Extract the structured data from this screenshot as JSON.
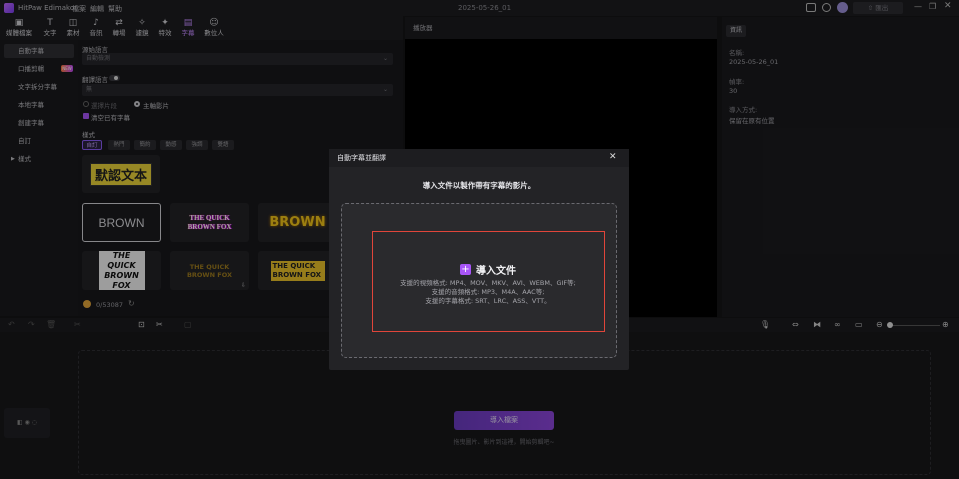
{
  "titlebar": {
    "app_name": "HitPaw Edimakor",
    "menu": [
      "檔案",
      "編輯",
      "幫助"
    ],
    "project_name": "2025-05-26_01",
    "export_label": "匯出"
  },
  "toolbar": {
    "items": [
      {
        "label": "媒體檔案",
        "icon": "media-icon"
      },
      {
        "label": "文字",
        "icon": "text-icon"
      },
      {
        "label": "素材",
        "icon": "elements-icon"
      },
      {
        "label": "音訊",
        "icon": "audio-icon"
      },
      {
        "label": "轉場",
        "icon": "transition-icon"
      },
      {
        "label": "濾鏡",
        "icon": "filter-icon"
      },
      {
        "label": "特效",
        "icon": "effects-icon"
      },
      {
        "label": "字幕",
        "icon": "subtitle-icon"
      },
      {
        "label": "數位人",
        "icon": "avatar-icon"
      }
    ],
    "active": "字幕"
  },
  "sidebar": {
    "items": [
      {
        "label": "自動字幕"
      },
      {
        "label": "口播剪輯"
      },
      {
        "label": "文字拆分字幕"
      },
      {
        "label": "本地字幕"
      },
      {
        "label": "創建字幕"
      },
      {
        "label": "自訂"
      },
      {
        "label": "樣式"
      }
    ],
    "new_badge": "NEW"
  },
  "subtitle_panel": {
    "source_lang_label": "源始語言",
    "source_lang_value": "自動檢測",
    "translate_label": "翻譯語言",
    "translate_value": "無",
    "option_selected_clip": "選擇片段",
    "option_main_video": "主軸影片",
    "clear_existing": "清空已有字幕",
    "style_label": "樣式",
    "style_chips": [
      "自訂",
      "熱門",
      "簡約",
      "動感",
      "強調",
      "雙語"
    ],
    "preset_text": "默認文本",
    "tiles": [
      "BROWN",
      "THE QUICK BROWN FOX",
      "BROWN",
      "THE QUICK BROWN FOX",
      "THE QUICK BROWN FOX",
      "THE QUICK BROWN FOX"
    ],
    "credits": "0/53087"
  },
  "player": {
    "header": "播放器"
  },
  "properties": {
    "tab": "資訊",
    "name_label": "名稱:",
    "name_value": "2025-05-26_01",
    "fps_label": "幀率:",
    "fps_value": "30",
    "import_mode_label": "導入方式:",
    "import_mode_value": "保留在原有位置"
  },
  "timeline": {
    "import_button": "導入檔案",
    "hint": "拖曳圖片、影片到這裡，開始剪輯吧~"
  },
  "dialog": {
    "title": "自動字幕並翻譯",
    "subtitle": "導入文件以製作帶有字幕的影片。",
    "import_label": "導入文件",
    "formats": [
      "支援的視頻格式: MP4、MOV、MKV、AVI、WEBM、GIF等;",
      "支援的音頻格式: MP3、M4A、AAC等;",
      "支援的字幕格式: SRT、LRC、ASS、VTT。"
    ]
  },
  "colors": {
    "accent": "#a855f7",
    "highlight_border": "#e0453a"
  }
}
